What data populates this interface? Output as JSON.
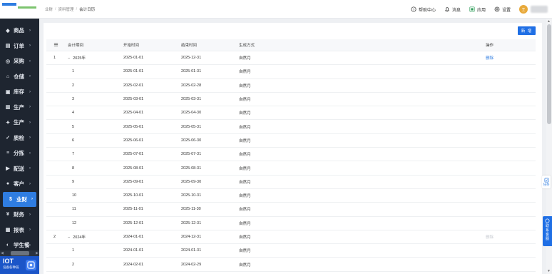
{
  "sidebar": {
    "items": [
      {
        "label": "商品",
        "icon": "tag-icon"
      },
      {
        "label": "订单",
        "icon": "file-icon"
      },
      {
        "label": "采购",
        "icon": "cart-icon"
      },
      {
        "label": "仓储",
        "icon": "warehouse-icon"
      },
      {
        "label": "库存",
        "icon": "box-icon"
      },
      {
        "label": "生产",
        "icon": "factory-icon"
      },
      {
        "label": "生产",
        "icon": "gear-icon"
      },
      {
        "label": "质检",
        "icon": "check-icon"
      },
      {
        "label": "分拣",
        "icon": "sort-icon"
      },
      {
        "label": "配送",
        "icon": "truck-icon"
      },
      {
        "label": "客户",
        "icon": "user-icon"
      },
      {
        "label": "业财",
        "icon": "finance-icon",
        "active": true
      },
      {
        "label": "财务",
        "icon": "money-icon"
      },
      {
        "label": "报表",
        "icon": "chart-icon"
      },
      {
        "label": "学生餐",
        "icon": "meal-icon"
      }
    ],
    "iot": {
      "title": "IOT",
      "subtitle": "设备各种链"
    }
  },
  "header": {
    "breadcrumb": [
      "业财",
      "资料管理",
      "会计日历"
    ],
    "help": "帮助中心",
    "messages": "消息",
    "apps": "应用",
    "settings": "设置",
    "avatar_text": "王"
  },
  "main": {
    "new_button": "新 增",
    "columns": [
      "会计期间",
      "开始时间",
      "结束时间",
      "生成方式",
      "操作"
    ],
    "rows": [
      {
        "idx": "1",
        "period": "2025年",
        "expand": "−",
        "start": "2025-01-01",
        "end": "2025-12-31",
        "mode": "自然月",
        "action": "删除"
      },
      {
        "idx": "",
        "period": "1",
        "start": "2025-01-01",
        "end": "2025-01-31",
        "mode": "自然月",
        "action": ""
      },
      {
        "idx": "",
        "period": "2",
        "start": "2025-02-01",
        "end": "2025-02-28",
        "mode": "自然月",
        "action": ""
      },
      {
        "idx": "",
        "period": "3",
        "start": "2025-03-01",
        "end": "2025-03-31",
        "mode": "自然月",
        "action": ""
      },
      {
        "idx": "",
        "period": "4",
        "start": "2025-04-01",
        "end": "2025-04-30",
        "mode": "自然月",
        "action": ""
      },
      {
        "idx": "",
        "period": "5",
        "start": "2025-05-01",
        "end": "2025-05-31",
        "mode": "自然月",
        "action": ""
      },
      {
        "idx": "",
        "period": "6",
        "start": "2025-06-01",
        "end": "2025-06-30",
        "mode": "自然月",
        "action": ""
      },
      {
        "idx": "",
        "period": "7",
        "start": "2025-07-01",
        "end": "2025-07-31",
        "mode": "自然月",
        "action": ""
      },
      {
        "idx": "",
        "period": "8",
        "start": "2025-08-01",
        "end": "2025-08-31",
        "mode": "自然月",
        "action": ""
      },
      {
        "idx": "",
        "period": "9",
        "start": "2025-09-01",
        "end": "2025-09-30",
        "mode": "自然月",
        "action": ""
      },
      {
        "idx": "",
        "period": "10",
        "start": "2025-10-01",
        "end": "2025-10-31",
        "mode": "自然月",
        "action": ""
      },
      {
        "idx": "",
        "period": "11",
        "start": "2025-11-01",
        "end": "2025-11-30",
        "mode": "自然月",
        "action": ""
      },
      {
        "idx": "",
        "period": "12",
        "start": "2025-12-01",
        "end": "2025-12-31",
        "mode": "自然月",
        "action": ""
      },
      {
        "idx": "2",
        "period": "2024年",
        "expand": "−",
        "start": "2024-01-01",
        "end": "2024-12-31",
        "mode": "自然月",
        "action": "删除",
        "action_dim": true
      },
      {
        "idx": "",
        "period": "1",
        "start": "2024-01-01",
        "end": "2024-01-31",
        "mode": "自然月",
        "action": ""
      },
      {
        "idx": "",
        "period": "2",
        "start": "2024-02-01",
        "end": "2024-02-29",
        "mode": "自然月",
        "action": ""
      }
    ]
  },
  "floating": {
    "task": "任务",
    "contact": [
      "联",
      "系",
      "客",
      "服"
    ]
  },
  "colors": {
    "accent": "#1f6fe5",
    "sidebar": "#1e2530"
  }
}
